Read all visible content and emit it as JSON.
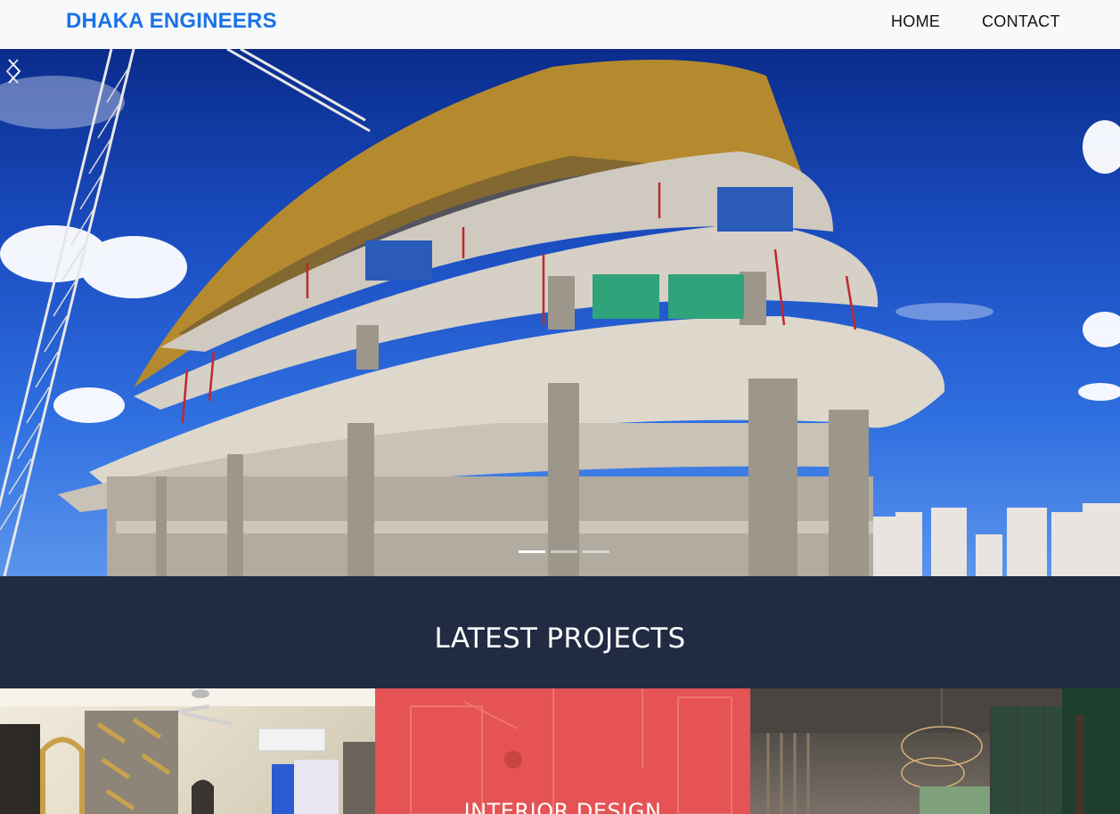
{
  "navbar": {
    "brand": "DHAKA ENGINEERS",
    "links": [
      {
        "label": "HOME"
      },
      {
        "label": "CONTACT"
      }
    ]
  },
  "carousel": {
    "slide_count": 3,
    "active_index": 0,
    "prev_icon": "chevron-left-icon",
    "next_icon": "chevron-right-icon"
  },
  "projects": {
    "title": "LATEST PROJECTS",
    "cards": [
      {
        "label": ""
      },
      {
        "label": "INTERIOR DESIGN"
      },
      {
        "label": ""
      }
    ]
  },
  "colors": {
    "brand": "#1a73e8",
    "projects_band": "#212b42",
    "card_overlay": "#e55354"
  }
}
